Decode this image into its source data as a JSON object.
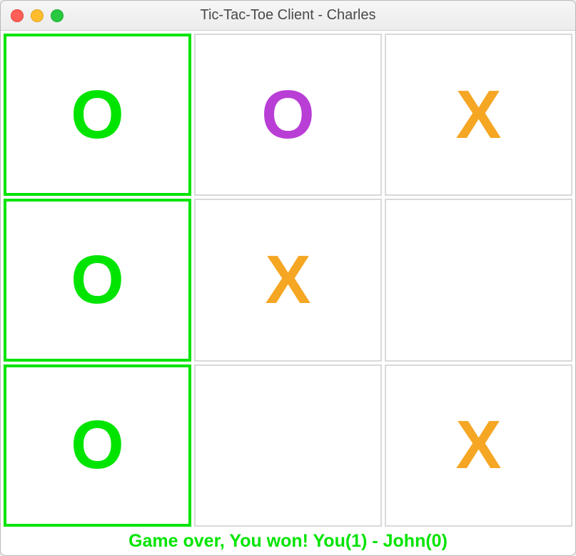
{
  "window": {
    "title": "Tic-Tac-Toe Client - Charles"
  },
  "colors": {
    "winHighlight": "#00e400",
    "markGreen": "#00e400",
    "markPurple": "#b93ed6",
    "markOrange": "#f5a623"
  },
  "board": {
    "cells": [
      {
        "mark": "O",
        "colorClass": "mark-green",
        "winning": true
      },
      {
        "mark": "O",
        "colorClass": "mark-purple",
        "winning": false
      },
      {
        "mark": "X",
        "colorClass": "mark-orange",
        "winning": false
      },
      {
        "mark": "O",
        "colorClass": "mark-green",
        "winning": true
      },
      {
        "mark": "X",
        "colorClass": "mark-orange",
        "winning": false
      },
      {
        "mark": "",
        "colorClass": "",
        "winning": false
      },
      {
        "mark": "O",
        "colorClass": "mark-green",
        "winning": true
      },
      {
        "mark": "",
        "colorClass": "",
        "winning": false
      },
      {
        "mark": "X",
        "colorClass": "mark-orange",
        "winning": false
      }
    ]
  },
  "status": {
    "message": "Game over, You won! You(1) - John(0)"
  }
}
